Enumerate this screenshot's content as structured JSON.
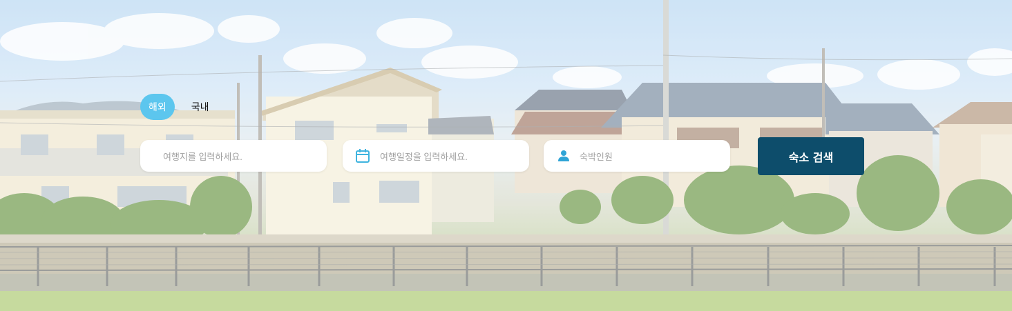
{
  "search": {
    "tabs": [
      {
        "label": "해외",
        "active": true
      },
      {
        "label": "국내",
        "active": false
      }
    ],
    "destination_placeholder": "여행지를 입력하세요.",
    "dates_placeholder": "여행일정을 입력하세요.",
    "guests_placeholder": "숙박인원",
    "submit_label": "숙소 검색"
  },
  "colors": {
    "accent": "#5cc6ee",
    "button": "#0d4d6b"
  },
  "icons": {
    "dates": "calendar-icon",
    "guests": "person-icon"
  }
}
